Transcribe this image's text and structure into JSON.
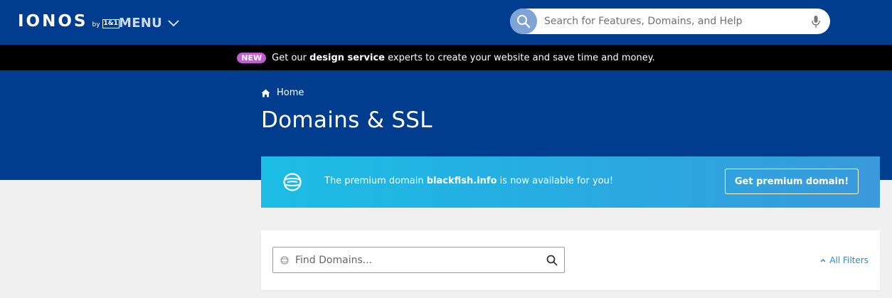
{
  "header": {
    "logo_text": "IONOS",
    "logo_by": "by",
    "logo_brand": "1&1",
    "menu_label": "MENU",
    "search_placeholder": "Search for Features, Domains, and Help",
    "icons": [
      "search-icon",
      "microphone-icon",
      "chevron-down-icon"
    ]
  },
  "promo": {
    "badge": "NEW",
    "text_before": "Get our",
    "text_bold": "design service",
    "text_after": "experts to create your website and save time and money."
  },
  "breadcrumb": {
    "home_label": "Home"
  },
  "page": {
    "title": "Domains & SSL"
  },
  "banner": {
    "text_before": "The premium domain",
    "domain": "blackfish.info",
    "text_after": "is now available for you!",
    "button_label": "Get premium domain!"
  },
  "filter_panel": {
    "find_placeholder": "Find Domains...",
    "filters_label": "All Filters"
  },
  "colors": {
    "header_blue": "#003d8f",
    "promo_black": "#000000",
    "badge_purple": "#c65bd8",
    "banner_cyan": "#1cbde4",
    "link_blue": "#2a8ecb",
    "page_background": "#f0f0f0"
  }
}
